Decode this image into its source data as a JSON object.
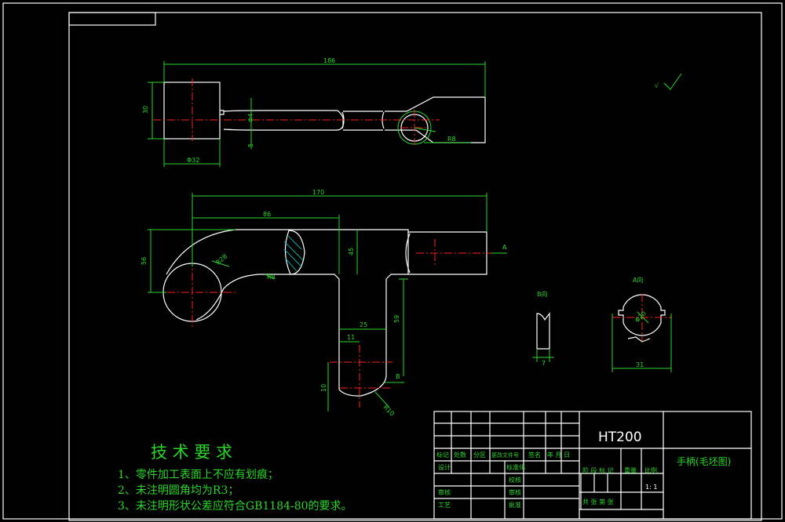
{
  "title_block": {
    "material": "HT200",
    "part_name": "手柄(毛坯图)",
    "header_row": [
      "标记",
      "处数",
      "分区",
      "更改文件号",
      "签名",
      "年 月 日"
    ],
    "left_rows": [
      "设计",
      "审核",
      "工艺"
    ],
    "mid_labels": [
      "标准化",
      "校核",
      "审核",
      "批准"
    ],
    "stage_row": [
      "阶 段 标 记",
      "重量",
      "比例"
    ],
    "scale": "1: 1",
    "sheet_row": "共   张 第   张"
  },
  "tech_requirements": {
    "heading": "技 术 要 求",
    "items": [
      "1、零件加工表面上不应有划痕；",
      "2、未注明圆角均为R3；",
      "3、未注明形状公差应符合GB1184-80的要求。"
    ]
  },
  "dimensions": {
    "top_total": "186",
    "top_height": "30",
    "top_left_width": "Φ32",
    "top_small": "Φ4",
    "top_small2": "5",
    "top_right": "R8",
    "front_total": "170",
    "front_86": "86",
    "front_height": "56",
    "front_r28": "R28",
    "front_mid": "45",
    "front_r8": "R8",
    "front_25": "25",
    "front_11": "11",
    "front_59": "59",
    "front_10": "10",
    "front_b": "B",
    "front_r": "R10",
    "front_a": "A",
    "view_b_label": "B向",
    "view_b_dim": "7",
    "view_a_label": "A向",
    "view_a_dia": "Φ20",
    "view_a_dim": "31",
    "roughness": "√"
  }
}
